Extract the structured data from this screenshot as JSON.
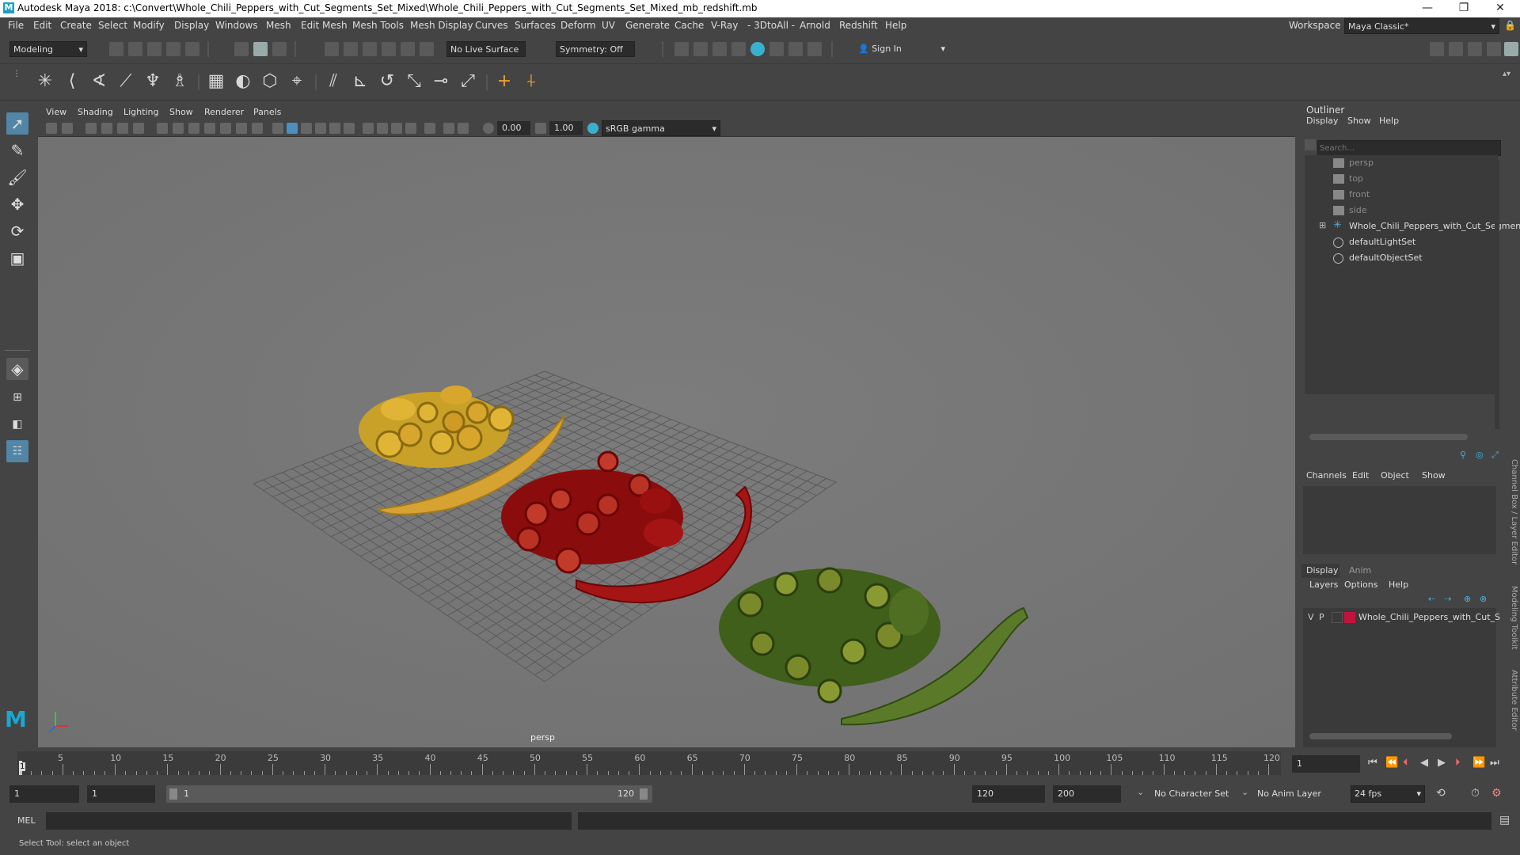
{
  "window": {
    "title": "Autodesk Maya 2018: c:\\Convert\\Whole_Chili_Peppers_with_Cut_Segments_Set_Mixed\\Whole_Chili_Peppers_with_Cut_Segments_Set_Mixed_mb_redshift.mb",
    "logo": "M",
    "minimize": "—",
    "maximize": "❐",
    "close": "✕"
  },
  "menubar": {
    "items": [
      "File",
      "Edit",
      "Create",
      "Select",
      "Modify",
      "Display",
      "Windows",
      "Mesh",
      "Edit Mesh",
      "Mesh Tools",
      "Mesh Display",
      "Curves",
      "Surfaces",
      "Deform",
      "UV",
      "Generate",
      "Cache",
      "V-Ray",
      "- 3DtoAll -",
      "Arnold",
      "Redshift",
      "Help"
    ],
    "workspace_label": "Workspace :",
    "workspace_value": "Maya Classic*"
  },
  "statusline": {
    "mode": "Modeling",
    "live_surface": "No Live Surface",
    "symmetry": "Symmetry: Off",
    "sign_in": "Sign In"
  },
  "viewport": {
    "menu": [
      "View",
      "Shading",
      "Lighting",
      "Show",
      "Renderer",
      "Panels"
    ],
    "exposure": "0.00",
    "gamma": "1.00",
    "color_space": "sRGB gamma",
    "camera_label": "persp"
  },
  "outliner": {
    "title": "Outliner",
    "menu": [
      "Display",
      "Show",
      "Help"
    ],
    "search_placeholder": "Search...",
    "items": [
      {
        "label": "persp",
        "type": "camera"
      },
      {
        "label": "top",
        "type": "camera"
      },
      {
        "label": "front",
        "type": "camera"
      },
      {
        "label": "side",
        "type": "camera"
      },
      {
        "label": "Whole_Chili_Peppers_with_Cut_Segmen",
        "type": "group"
      },
      {
        "label": "defaultLightSet",
        "type": "set"
      },
      {
        "label": "defaultObjectSet",
        "type": "set"
      }
    ]
  },
  "channelbox": {
    "menu": [
      "Channels",
      "Edit",
      "Object",
      "Show"
    ]
  },
  "layereditor": {
    "tabs": [
      "Display",
      "Anim"
    ],
    "menu": [
      "Layers",
      "Options",
      "Help"
    ],
    "layer": {
      "v": "V",
      "p": "P",
      "name": "Whole_Chili_Peppers_with_Cut_S",
      "color": "#c0143c"
    }
  },
  "side_tabs": [
    "Channel Box / Layer Editor",
    "Modeling Toolkit",
    "Attribute Editor"
  ],
  "timeline": {
    "ticks": [
      "5",
      "10",
      "15",
      "20",
      "25",
      "30",
      "35",
      "40",
      "45",
      "50",
      "55",
      "60",
      "65",
      "70",
      "75",
      "80",
      "85",
      "90",
      "95",
      "100",
      "105",
      "110",
      "115",
      "120"
    ],
    "current_frame": "1",
    "current_frame_field": "1"
  },
  "range": {
    "start": "1",
    "playback_start": "1",
    "slider_start": "1",
    "slider_end": "120",
    "playback_end": "120",
    "end": "200",
    "character_set": "No Character Set",
    "anim_layer": "No Anim Layer",
    "fps": "24 fps"
  },
  "command": {
    "label": "MEL"
  },
  "helpline": {
    "text": "Select Tool: select an object"
  }
}
